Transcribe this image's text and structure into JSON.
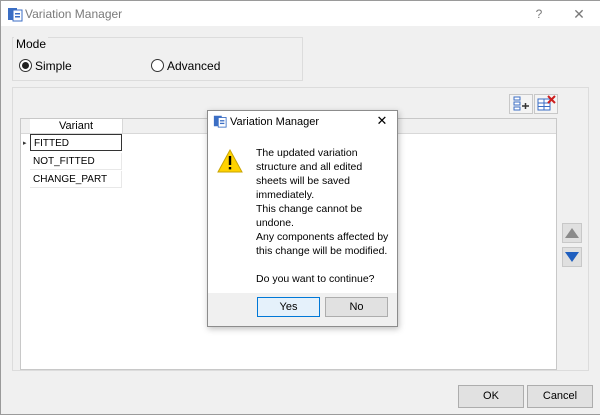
{
  "window": {
    "title": "Variation Manager",
    "help_label": "?",
    "close_label": "✕"
  },
  "mode": {
    "label": "Mode",
    "options": [
      {
        "label": "Simple",
        "selected": true
      },
      {
        "label": "Advanced",
        "selected": false
      }
    ]
  },
  "toolbar": {
    "add_icon": "add-row-icon",
    "delete_icon": "delete-row-icon"
  },
  "grid": {
    "column_header": "Variant",
    "rows": [
      "FITTED",
      "NOT_FITTED",
      "CHANGE_PART"
    ],
    "selected_row": 0,
    "row_marker": "▸"
  },
  "side_buttons": {
    "up_icon": "move-up-icon",
    "down_icon": "move-down-icon"
  },
  "footer": {
    "ok_label": "OK",
    "cancel_label": "Cancel"
  },
  "dialog": {
    "title": "Variation Manager",
    "close_label": "✕",
    "icon": "warning-icon",
    "message_lines": [
      "The updated variation",
      "structure and all edited",
      "sheets will be saved",
      "immediately.",
      "This change cannot be",
      "undone.",
      "Any components affected by",
      "this change will be modified.",
      "",
      "Do you want to continue?"
    ],
    "yes_label": "Yes",
    "no_label": "No"
  },
  "colors": {
    "warning": "#ffd200",
    "arrow_up": "#8a8a8a",
    "arrow_down": "#1f5fbf",
    "delete_accent": "#cc1f1f",
    "focus_border": "#0078d7"
  }
}
